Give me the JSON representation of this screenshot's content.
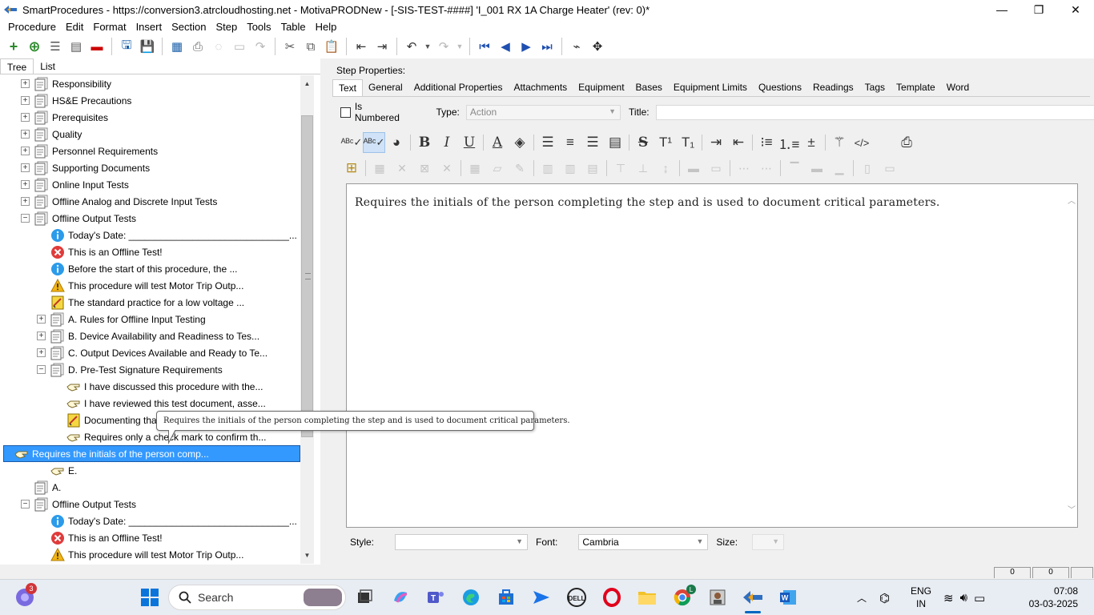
{
  "window": {
    "title": "SmartProcedures - https://conversion3.atrcloudhosting.net - MotivaPRODNew - [-SIS-TEST-####] 'I_001 RX 1A Charge Heater' (rev: 0)*",
    "minimize": "—",
    "maximize": "❐",
    "close": "✕"
  },
  "menu": [
    "Procedure",
    "Edit",
    "Format",
    "Insert",
    "Section",
    "Step",
    "Tools",
    "Table",
    "Help"
  ],
  "left_panel": {
    "tabs": [
      "Tree",
      "List"
    ],
    "tree": [
      {
        "label": "Responsibility",
        "level": 0,
        "expander": "+",
        "icon": "section-icon"
      },
      {
        "label": "HS&E Precautions",
        "level": 0,
        "expander": "+",
        "icon": "section-icon"
      },
      {
        "label": "Prerequisites",
        "level": 0,
        "expander": "+",
        "icon": "section-icon"
      },
      {
        "label": "Quality",
        "level": 0,
        "expander": "+",
        "icon": "section-icon"
      },
      {
        "label": "Personnel Requirements",
        "level": 0,
        "expander": "+",
        "icon": "section-icon"
      },
      {
        "label": "Supporting Documents",
        "level": 0,
        "expander": "+",
        "icon": "section-icon"
      },
      {
        "label": "Online Input Tests",
        "level": 0,
        "expander": "+",
        "icon": "section-icon"
      },
      {
        "label": "Offline Analog and Discrete Input Tests",
        "level": 0,
        "expander": "+",
        "icon": "section-icon"
      },
      {
        "label": "Offline Output Tests",
        "level": 0,
        "expander": "−",
        "icon": "section-icon"
      },
      {
        "label": "Today's Date: ______________________________...",
        "level": 1,
        "expander": "",
        "icon": "info-icon"
      },
      {
        "label": "This is an Offline Test!",
        "level": 1,
        "expander": "",
        "icon": "error-icon"
      },
      {
        "label": "Before the start of this procedure, the ...",
        "level": 1,
        "expander": "",
        "icon": "info-icon"
      },
      {
        "label": "This procedure will test Motor Trip Outp...",
        "level": 1,
        "expander": "",
        "icon": "warning-icon"
      },
      {
        "label": "The standard practice for a low voltage ...",
        "level": 1,
        "expander": "",
        "icon": "notebook-icon"
      },
      {
        "label": "A. Rules for Offline Input Testing",
        "level": 1,
        "expander": "+",
        "icon": "section-icon"
      },
      {
        "label": "B. Device Availability and Readiness to Tes...",
        "level": 1,
        "expander": "+",
        "icon": "section-icon"
      },
      {
        "label": "C. Output Devices Available and Ready to Te...",
        "level": 1,
        "expander": "+",
        "icon": "section-icon"
      },
      {
        "label": "D. Pre-Test Signature Requirements",
        "level": 1,
        "expander": "−",
        "icon": "section-icon"
      },
      {
        "label": "I have discussed this procedure with the...",
        "level": 2,
        "expander": "",
        "icon": "action-hand-icon"
      },
      {
        "label": "I have reviewed this test document, asse...",
        "level": 2,
        "expander": "",
        "icon": "action-hand-icon"
      },
      {
        "label": "Documenting that",
        "level": 2,
        "expander": "",
        "icon": "notebook-icon"
      },
      {
        "label": "Requires only a check mark to confirm th...",
        "level": 2,
        "expander": "",
        "icon": "action-hand-icon"
      },
      {
        "label": "Requires the initials of the person comp...",
        "level": 2,
        "expander": "",
        "icon": "action-hand-icon",
        "selected": true
      },
      {
        "label": "E.",
        "level": 1,
        "expander": "",
        "icon": "action-hand-icon"
      },
      {
        "label": "A.",
        "level": 0,
        "expander": "",
        "icon": "section-icon"
      },
      {
        "label": "Offline Output Tests",
        "level": 0,
        "expander": "−",
        "icon": "section-icon"
      },
      {
        "label": "Today's Date: ______________________________...",
        "level": 1,
        "expander": "",
        "icon": "info-icon"
      },
      {
        "label": "This is an Offline Test!",
        "level": 1,
        "expander": "",
        "icon": "error-icon"
      },
      {
        "label": "This procedure will test Motor Trip Outp...",
        "level": 1,
        "expander": "",
        "icon": "warning-icon"
      }
    ]
  },
  "tooltip": "Requires the initials of the person completing the step and is used to document critical parameters.",
  "step_properties": {
    "label": "Step Properties:",
    "tabs": [
      "Text",
      "General",
      "Additional Properties",
      "Attachments",
      "Equipment",
      "Bases",
      "Equipment Limits",
      "Questions",
      "Readings",
      "Tags",
      "Template",
      "Word"
    ],
    "is_numbered_label": "Is Numbered",
    "type_label": "Type:",
    "type_value": "Action",
    "title_label": "Title:",
    "title_value": "",
    "editor_text": "Requires the initials of the person completing the step and is used to document critical parameters.",
    "style_label": "Style:",
    "style_value": "",
    "font_label": "Font:",
    "font_value": "Cambria",
    "size_label": "Size:",
    "size_value": ""
  },
  "status": {
    "box1": "0",
    "box2": "0"
  },
  "taskbar": {
    "search_placeholder": "Search",
    "notification_count": "3",
    "lang_line1": "ENG",
    "lang_line2": "IN",
    "time": "07:08",
    "date": "03-03-2025"
  }
}
